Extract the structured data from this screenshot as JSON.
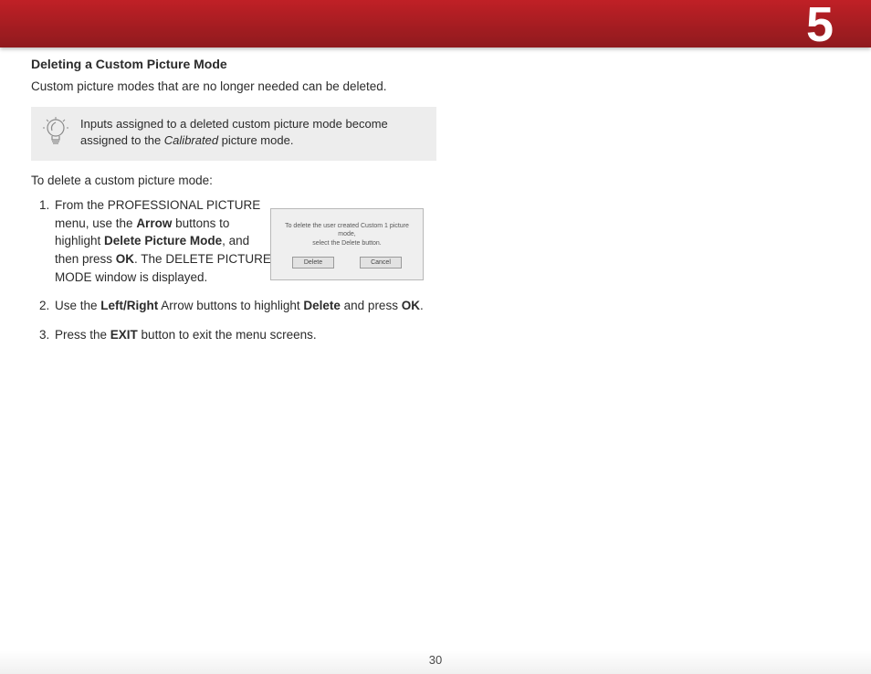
{
  "chapter_number": "5",
  "section_title": "Deleting a Custom Picture Mode",
  "intro_paragraph": "Custom picture modes that are no longer needed can be deleted.",
  "callout_note": {
    "pre": "Inputs assigned to a deleted custom picture mode become assigned to the ",
    "italic": "Calibrated",
    "post": " picture mode."
  },
  "lead_in": "To delete a custom picture mode:",
  "steps": {
    "s1": {
      "t1": "From the PROFESSIONAL PICTURE menu, use the ",
      "b1": "Arrow",
      "t2": " buttons to highlight ",
      "b2": "Delete Picture Mode",
      "t3": ", and then press ",
      "b3": "OK",
      "t4": ". The DELETE PICTURE MODE window is displayed."
    },
    "s2": {
      "t1": "Use the ",
      "b1": "Left/Right",
      "t2": " Arrow buttons to highlight ",
      "b2": "Delete",
      "t3": " and press ",
      "b3": "OK",
      "t4": "."
    },
    "s3": {
      "t1": "Press the ",
      "b1": "EXIT",
      "t2": " button to exit the menu screens."
    }
  },
  "dialog": {
    "message_line1": "To delete the user created Custom 1 picture mode,",
    "message_line2": "select the Delete button.",
    "btn_delete": "Delete",
    "btn_cancel": "Cancel"
  },
  "page_number": "30"
}
